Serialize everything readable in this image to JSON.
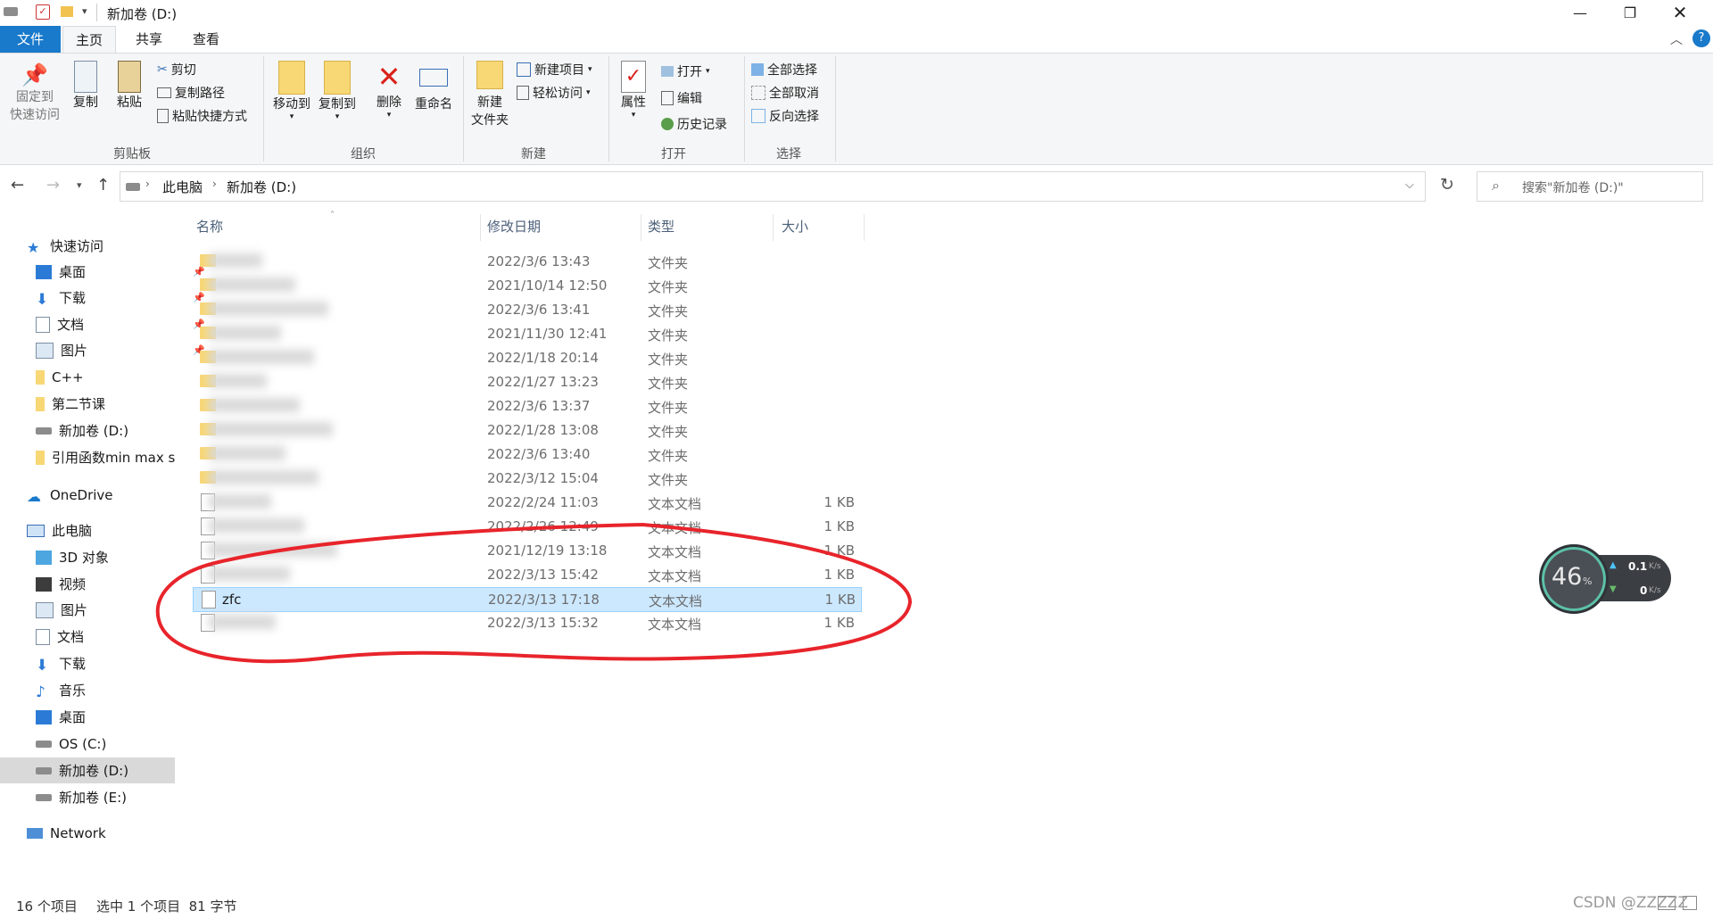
{
  "window": {
    "title": "新加卷 (D:)"
  },
  "tabs": [
    "文件",
    "主页",
    "共享",
    "查看"
  ],
  "ribbon": {
    "clipboard": {
      "pin_line1": "固定到",
      "pin_line2": "快速访问",
      "copy": "复制",
      "paste": "粘贴",
      "cut": "剪切",
      "copy_path": "复制路径",
      "paste_shortcut": "粘贴快捷方式",
      "label": "剪贴板"
    },
    "organize": {
      "move_to": "移动到",
      "copy_to": "复制到",
      "delete": "删除",
      "rename": "重命名",
      "label": "组织"
    },
    "new": {
      "new_folder_line1": "新建",
      "new_folder_line2": "文件夹",
      "new_item": "新建项目",
      "easy_access": "轻松访问",
      "label": "新建"
    },
    "open": {
      "properties": "属性",
      "open": "打开",
      "edit": "编辑",
      "history": "历史记录",
      "label": "打开"
    },
    "select": {
      "select_all": "全部选择",
      "select_none": "全部取消",
      "invert": "反向选择",
      "label": "选择"
    }
  },
  "address": {
    "segments": [
      "此电脑",
      "新加卷 (D:)"
    ],
    "search_placeholder": "搜索\"新加卷 (D:)\""
  },
  "nav": {
    "quick_access": "快速访问",
    "quick_items": [
      "桌面",
      "下载",
      "文档",
      "图片",
      "C++",
      "第二节课",
      "新加卷 (D:)",
      "引用函数min max s"
    ],
    "onedrive": "OneDrive",
    "this_pc": "此电脑",
    "pc_items": [
      "3D 对象",
      "视频",
      "图片",
      "文档",
      "下载",
      "音乐",
      "桌面",
      "OS (C:)",
      "新加卷 (D:)",
      "新加卷 (E:)"
    ],
    "network": "Network"
  },
  "columns": {
    "name": "名称",
    "date": "修改日期",
    "type": "类型",
    "size": "大小"
  },
  "files": [
    {
      "name": "",
      "date": "2022/3/6 13:43",
      "type": "文件夹",
      "size": "",
      "kind": "folder"
    },
    {
      "name": "",
      "date": "2021/10/14 12:50",
      "type": "文件夹",
      "size": "",
      "kind": "folder"
    },
    {
      "name": "",
      "date": "2022/3/6 13:41",
      "type": "文件夹",
      "size": "",
      "kind": "folder"
    },
    {
      "name": "",
      "date": "2021/11/30 12:41",
      "type": "文件夹",
      "size": "",
      "kind": "folder"
    },
    {
      "name": "",
      "date": "2022/1/18 20:14",
      "type": "文件夹",
      "size": "",
      "kind": "folder"
    },
    {
      "name": "",
      "date": "2022/1/27 13:23",
      "type": "文件夹",
      "size": "",
      "kind": "folder"
    },
    {
      "name": "",
      "date": "2022/3/6 13:37",
      "type": "文件夹",
      "size": "",
      "kind": "folder"
    },
    {
      "name": "",
      "date": "2022/1/28 13:08",
      "type": "文件夹",
      "size": "",
      "kind": "folder"
    },
    {
      "name": "",
      "date": "2022/3/6 13:40",
      "type": "文件夹",
      "size": "",
      "kind": "folder"
    },
    {
      "name": "",
      "date": "2022/3/12 15:04",
      "type": "文件夹",
      "size": "",
      "kind": "folder"
    },
    {
      "name": "",
      "date": "2022/2/24 11:03",
      "type": "文本文档",
      "size": "1 KB",
      "kind": "doc"
    },
    {
      "name": "",
      "date": "2022/2/26 12:49",
      "type": "文本文档",
      "size": "1 KB",
      "kind": "doc"
    },
    {
      "name": "",
      "date": "2021/12/19 13:18",
      "type": "文本文档",
      "size": "1 KB",
      "kind": "doc"
    },
    {
      "name": "",
      "date": "2022/3/13 15:42",
      "type": "文本文档",
      "size": "1 KB",
      "kind": "doc"
    },
    {
      "name": "zfc",
      "date": "2022/3/13 17:18",
      "type": "文本文档",
      "size": "1 KB",
      "kind": "doc",
      "selected": true
    },
    {
      "name": "",
      "date": "2022/3/13 15:32",
      "type": "文本文档",
      "size": "1 KB",
      "kind": "doc"
    }
  ],
  "status": {
    "count": "16 个项目",
    "selection": "选中 1 个项目  81 字节"
  },
  "net_widget": {
    "percent": "46",
    "percent_unit": "%",
    "up": "0.1",
    "up_unit": "K/s",
    "down": "0",
    "down_unit": "K/s"
  },
  "watermark": "CSDN @ZZZZZ",
  "colors": {
    "accent": "#1979ca",
    "selection": "#cce8ff",
    "annotation": "#e8242b"
  }
}
